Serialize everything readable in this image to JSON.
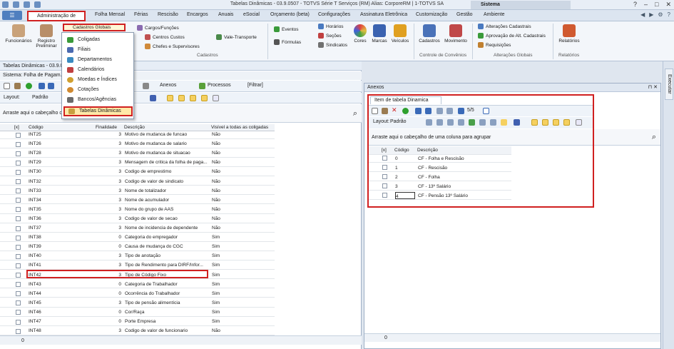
{
  "window": {
    "title": "Tabelas Dinâmicas - 03.9.0507 - TOTVS Série T Serviços (RM) Alias: CorporeRM | 1-TOTVS SA",
    "system_label": "Sistema",
    "controls": [
      "?",
      "–",
      "□",
      "✕"
    ]
  },
  "menu_tabs": [
    "Administração de Pessoal",
    "Folha Mensal",
    "Férias",
    "Rescisão",
    "Encargos",
    "Anuais",
    "eSocial",
    "Orçamento (beta)",
    "Configurações",
    "Assinatura Eletrônica",
    "Customização",
    "Gestão",
    "Ambiente"
  ],
  "ribbon": {
    "funcionarios": "Funcionários",
    "registro_preliminar": "Registro Preliminar",
    "cadastros_globais": "Cadastros Globais",
    "cargos": "Cargos/Funções",
    "centros": "Centros Custos",
    "chefes": "Chefes e Supervisores",
    "vale": "Vale-Transporte",
    "eventos": "Eventos",
    "formulas": "Fórmulas",
    "horarios": "Horários",
    "secoes": "Seções",
    "sindicatos": "Sindicatos",
    "cores": "Cores",
    "marcas": "Marcas",
    "veiculos": "Veículos",
    "cadastros_btn": "Cadastros",
    "movimento": "Movimento",
    "alteracoes": "Alterações Cadastrais",
    "aprovacao": "Aprovação de Alt. Cadastrais",
    "requisicoes": "Requisições",
    "relatorios": "Relatórios",
    "grp_cadastros": "Cadastros",
    "grp_convenios": "Controle de Convênios",
    "grp_alteracoes": "Alterações Globais",
    "grp_relatorios": "Relatórios"
  },
  "dropdown": [
    "Coligadas",
    "Filiais",
    "Departamentos",
    "Calendários",
    "Moedas e Índices",
    "Cotações",
    "Bancos/Agências",
    "Tabelas Dinâmicas"
  ],
  "left": {
    "tab_title": "Tabelas Dinâmicas - 03.9.0...",
    "sistema_label": "Sistema:",
    "sistema_value": "Folha de Pagam...",
    "anexos": "Anexos",
    "processos": "Processos",
    "filtrar": "[Filtrar]",
    "layout_label": "Layout:",
    "layout_value": "Padrão",
    "group_hint": "Arraste aqui o cabeçalho de",
    "columns": [
      "[x]",
      "Código",
      "Finalidade",
      "Descrição",
      "Visível a todas as coligadas"
    ],
    "rows": [
      [
        "INT25",
        "3",
        "Motivo de mudanca de funcao",
        "Não"
      ],
      [
        "INT26",
        "3",
        "Motivo de mudanca de salario",
        "Não"
      ],
      [
        "INT28",
        "3",
        "Motivo de mudanca de situacao",
        "Não"
      ],
      [
        "INT29",
        "3",
        "Mensagem de critica da folha de paga...",
        "Não"
      ],
      [
        "INT30",
        "3",
        "Codigo de emprestimo",
        "Não"
      ],
      [
        "INT32",
        "3",
        "Codigo de valor de sindicato",
        "Não"
      ],
      [
        "INT33",
        "3",
        "Nome de totalizador",
        "Não"
      ],
      [
        "INT34",
        "3",
        "Nome de acumulador",
        "Não"
      ],
      [
        "INT35",
        "3",
        "Nome do grupo de AAS",
        "Não"
      ],
      [
        "INT36",
        "3",
        "Codigo de valor de secao",
        "Não"
      ],
      [
        "INT37",
        "3",
        "Nome de incidencia de dependente",
        "Não"
      ],
      [
        "INT38",
        "0",
        "Categoria do empregador",
        "Sim"
      ],
      [
        "INT39",
        "0",
        "Causa de mudança do CGC",
        "Sim"
      ],
      [
        "INT40",
        "3",
        "Tipo de anotação",
        "Sim"
      ],
      [
        "INT41",
        "3",
        "Tipo de Rendimento para DIRF/Infor...",
        "Sim"
      ],
      [
        "INT42",
        "3",
        "Tipo de Código Fixo",
        "Sim"
      ],
      [
        "INT43",
        "0",
        "Categoria de Trabalhador",
        "Sim"
      ],
      [
        "INT44",
        "0",
        "Ocorrência do Trabalhador",
        "Sim"
      ],
      [
        "INT45",
        "3",
        "Tipo de pensão alimentícia",
        "Sim"
      ],
      [
        "INT46",
        "0",
        "Cor/Raça",
        "Sim"
      ],
      [
        "INT47",
        "0",
        "Porte Empresa",
        "Sim"
      ],
      [
        "INT48",
        "3",
        "Codigo de valor de funcionario",
        "Não"
      ]
    ],
    "footer_count": "0"
  },
  "right": {
    "panel_title": "Anexos",
    "tab_label": "Item de tabela Dinamica",
    "counter": "5/5",
    "layout_label": "Layout:",
    "layout_value": "Padrão",
    "group_hint": "Arraste aqui o cabeçalho de uma coluna para agrupar",
    "columns": [
      "[x]",
      "Código",
      "Descrição"
    ],
    "rows": [
      [
        "0",
        "CF - Folha e Rescisão"
      ],
      [
        "1",
        "CF - Rescisão"
      ],
      [
        "2",
        "CF - Folha"
      ],
      [
        "3",
        "CF - 13º Salário"
      ],
      [
        "4",
        "CF - Pensão 13º Salário"
      ]
    ],
    "footer_count": "0",
    "side_tab": "Executar"
  },
  "colors": {
    "highlight_red": "#d02020",
    "accent_blue": "#4f7fbf",
    "selected_yellow": "#ffe9a8"
  }
}
